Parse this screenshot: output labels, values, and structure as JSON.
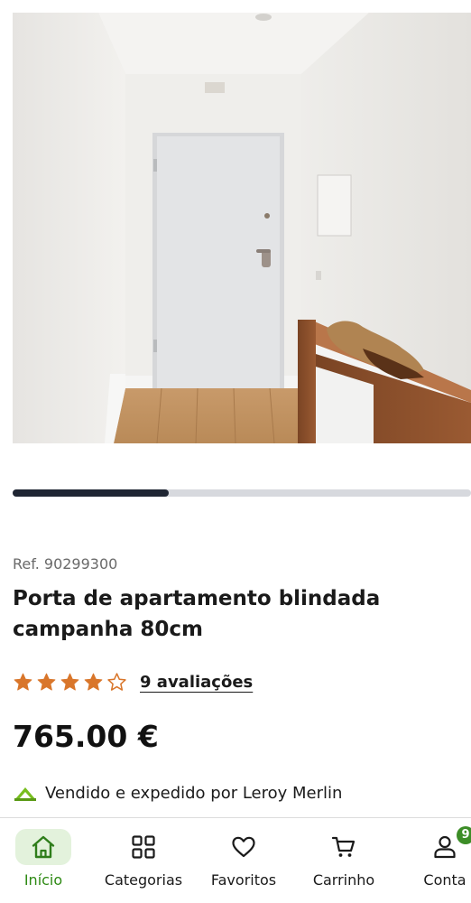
{
  "product": {
    "ref": "Ref. 90299300",
    "title": "Porta de apartamento blindada campanha 80cm",
    "rating": 4,
    "rating_max": 5,
    "reviews_label": "9 avaliações",
    "price": "765.00 €",
    "seller_text": "Vendido e expedido por Leroy Merlin",
    "seller_logo_icon": "leroy-merlin-logo-icon"
  },
  "gallery": {
    "image_subject": "white-door-hallway-photo",
    "progress_fraction": 0.34
  },
  "colors": {
    "accent_green": "#3c8d27",
    "active_label_green": "#2e8a14",
    "star_orange": "#d9762b",
    "progress_fill": "#1f2533"
  },
  "nav": {
    "items": [
      {
        "label": "Início",
        "icon": "home-icon",
        "active": true
      },
      {
        "label": "Categorias",
        "icon": "grid-icon",
        "active": false
      },
      {
        "label": "Favoritos",
        "icon": "heart-icon",
        "active": false
      },
      {
        "label": "Carrinho",
        "icon": "cart-icon",
        "active": false
      },
      {
        "label": "Conta",
        "icon": "user-icon",
        "active": false,
        "badge": "9"
      }
    ]
  }
}
